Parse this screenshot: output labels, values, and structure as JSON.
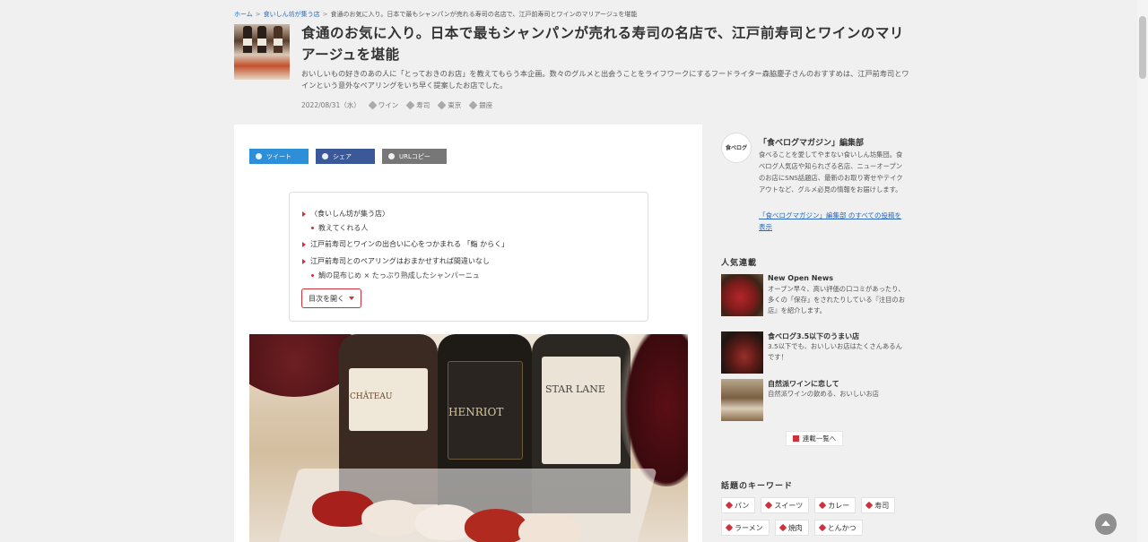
{
  "breadcrumb": {
    "home": "ホーム",
    "category": "食いしん坊が集う店",
    "current": "食通のお気に入り。日本で最もシャンパンが売れる寿司の名店で、江戸前寿司とワインのマリアージュを堪能",
    "separator": ">"
  },
  "article": {
    "title": "食通のお気に入り。日本で最もシャンパンが売れる寿司の名店で、江戸前寿司とワインのマリアージュを堪能",
    "lead": "おいしいもの好きのあの人に「とっておきのお店」を教えてもらう本企画。数々のグルメと出会うことをライフワークにするフードライター森脇慶子さんのおすすめは、江戸前寿司とワインという意外なペアリングをいち早く提案したお店でした。",
    "date": "2022/08/31（水）",
    "tags": [
      "ワイン",
      "寿司",
      "東京",
      "銀座"
    ]
  },
  "share": {
    "tweet": "ツイート",
    "facebook": "シェア",
    "url_copy": "URLコピー"
  },
  "toc": {
    "items": [
      {
        "label": "〈食いしん坊が集う店〉",
        "sub": "教えてくれる人"
      },
      {
        "label": "江戸前寿司とワインの出合いに心をつかまれる 「鮨 からく」",
        "sub": ""
      },
      {
        "label": "江戸前寿司とのペアリングはおまかせすれば間違いなし",
        "sub": "鯛の昆布じめ × たっぷり熟成したシャンパーニュ"
      }
    ],
    "open_button": "目次を開く"
  },
  "author": {
    "avatar_text": "食べログ",
    "name": "「食べログマガジン」編集部",
    "bio": "食べることを愛してやまない食いしん坊集団。食べログ人気店や知られざる名店、ニューオープンのお店にSNS話題店、最新のお取り寄せやテイクアウトなど、グルメ必見の情報をお届けします。",
    "link": "「食べログマガジン」編集部 のすべての投稿を表示"
  },
  "popular": {
    "title": "人気連載",
    "items": [
      {
        "title": "New Open News",
        "desc": "オープン早々、高い評価の口コミがあったり、多くの「保存」をされたりしている『注目のお店』を紹介します。"
      },
      {
        "title": "食べログ3.5以下のうまい店",
        "desc": "3.5以下でも、おいしいお店はたくさんあるんです！"
      },
      {
        "title": "自然派ワインに恋して",
        "desc": "自然派ワインの飲める、おいしいお店"
      }
    ],
    "all_label": "連載一覧へ"
  },
  "keywords": {
    "title": "話題のキーワード",
    "items": [
      "パン",
      "スイーツ",
      "カレー",
      "寿司",
      "ラーメン",
      "焼肉",
      "とんかつ"
    ]
  },
  "photo": {
    "bottle_labels": [
      "CHÂTEAU",
      "HENRIOT",
      "STAR LANE"
    ]
  },
  "colors": {
    "accent": "#d0303a",
    "link": "#2a6ab8",
    "twitter": "#2e8fd9",
    "facebook": "#3b5998",
    "url_copy": "#777777"
  }
}
